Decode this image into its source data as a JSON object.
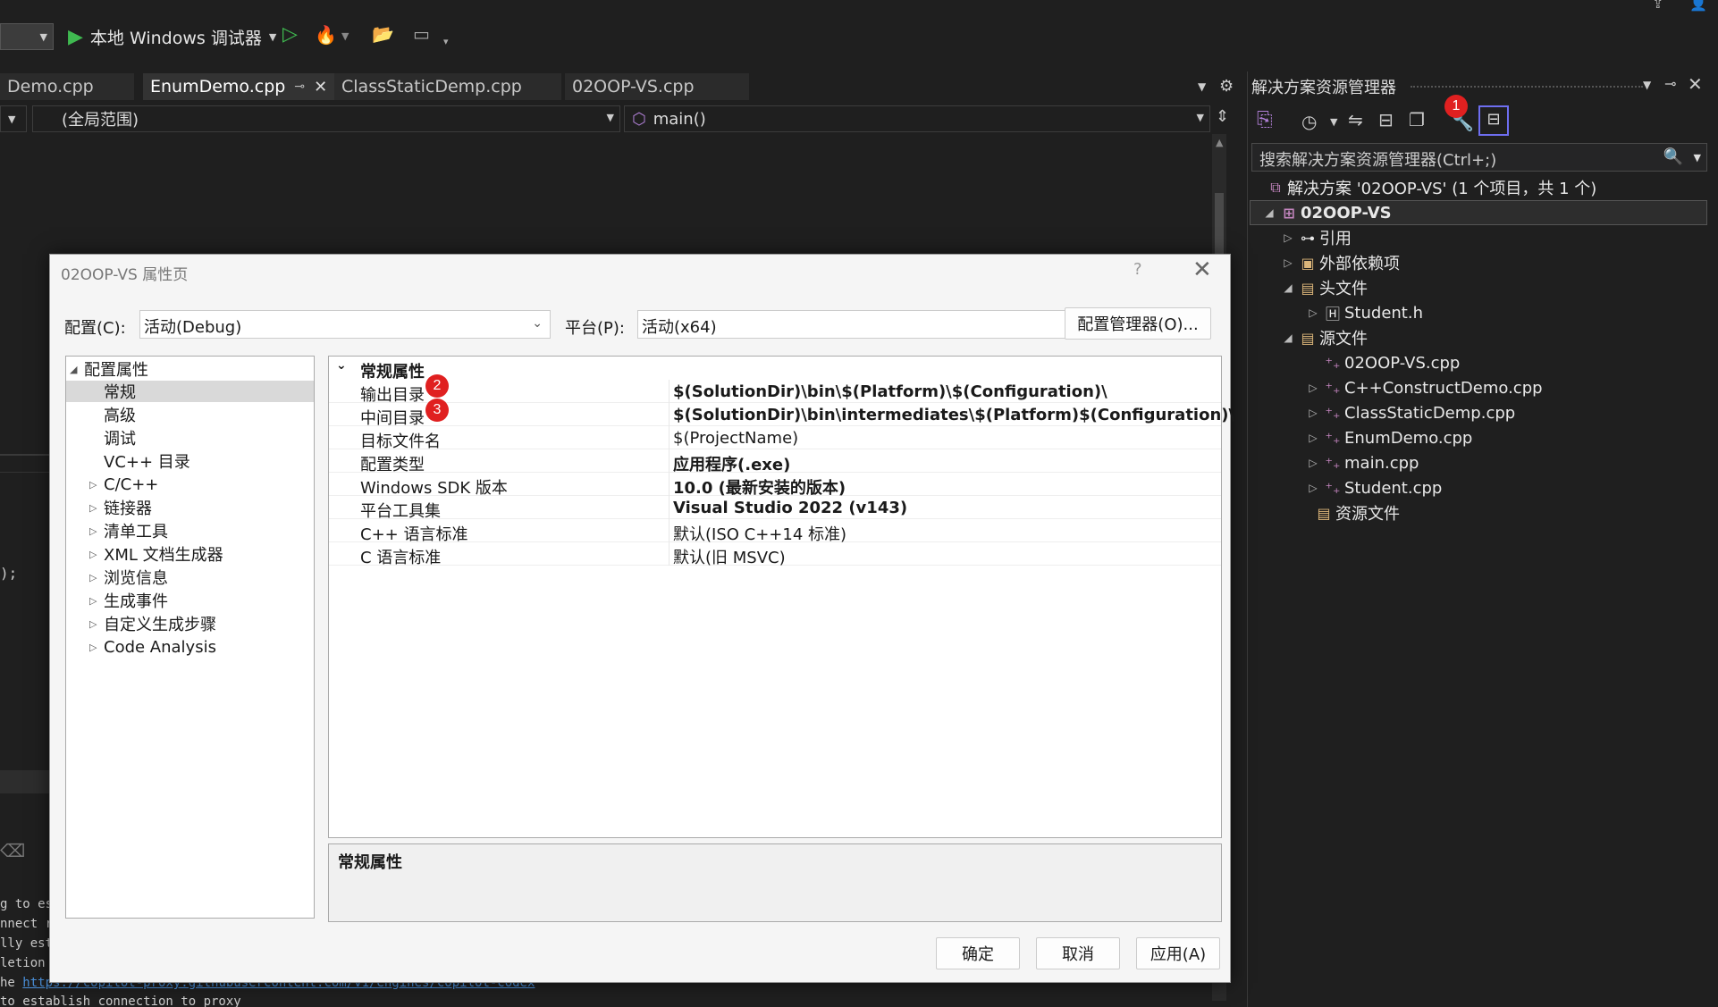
{
  "toolbar": {
    "debugger_label": "本地 Windows 调试器"
  },
  "editor": {
    "tabs": [
      {
        "label": "Demo.cpp"
      },
      {
        "label": "EnumDemo.cpp"
      },
      {
        "label": "ClassStaticDemp.cpp"
      },
      {
        "label": "02OOP-VS.cpp"
      }
    ],
    "scope": "(全局范围)",
    "member": "main()"
  },
  "output": {
    "lines": [
      "g to es",
      "nnect r",
      "lly est",
      "letion",
      "he ",
      "to establish connection to proxy"
    ],
    "link": "https://copilot-proxy.githubusercontent.com/v1/engines/copilot-codex",
    "code_fragment": ");"
  },
  "solution_explorer": {
    "title": "解决方案资源管理器",
    "search_placeholder": "搜索解决方案资源管理器(Ctrl+;)",
    "solution": "解决方案 '02OOP-VS' (1 个项目，共 1 个)",
    "project": "02OOP-VS",
    "items": [
      {
        "label": "引用"
      },
      {
        "label": "外部依赖项"
      },
      {
        "label": "头文件"
      },
      {
        "label": "Student.h"
      },
      {
        "label": "源文件"
      },
      {
        "label": "02OOP-VS.cpp"
      },
      {
        "label": "C++ConstructDemo.cpp"
      },
      {
        "label": "ClassStaticDemp.cpp"
      },
      {
        "label": "EnumDemo.cpp"
      },
      {
        "label": "main.cpp"
      },
      {
        "label": "Student.cpp"
      },
      {
        "label": "资源文件"
      }
    ]
  },
  "badges": [
    "1",
    "2",
    "3"
  ],
  "dialog": {
    "title": "02OOP-VS 属性页",
    "help": "?",
    "close": "✕",
    "config_label": "配置(C):",
    "config_value": "活动(Debug)",
    "platform_label": "平台(P):",
    "platform_value": "活动(x64)",
    "config_manager": "配置管理器(O)...",
    "left_tree": [
      {
        "label": "配置属性"
      },
      {
        "label": "常规"
      },
      {
        "label": "高级"
      },
      {
        "label": "调试"
      },
      {
        "label": "VC++ 目录"
      },
      {
        "label": "C/C++"
      },
      {
        "label": "链接器"
      },
      {
        "label": "清单工具"
      },
      {
        "label": "XML 文档生成器"
      },
      {
        "label": "浏览信息"
      },
      {
        "label": "生成事件"
      },
      {
        "label": "自定义生成步骤"
      },
      {
        "label": "Code Analysis"
      }
    ],
    "grid_header": "常规属性",
    "properties": [
      {
        "key": "输出目录",
        "value": "$(SolutionDir)\\bin\\$(Platform)\\$(Configuration)\\"
      },
      {
        "key": "中间目录",
        "value": "$(SolutionDir)\\bin\\intermediates\\$(Platform)$(Configuration)\\"
      },
      {
        "key": "目标文件名",
        "value": "$(ProjectName)"
      },
      {
        "key": "配置类型",
        "value": "应用程序(.exe)"
      },
      {
        "key": "Windows SDK 版本",
        "value": "10.0 (最新安装的版本)"
      },
      {
        "key": "平台工具集",
        "value": "Visual Studio 2022 (v143)"
      },
      {
        "key": "C++ 语言标准",
        "value": "默认(ISO C++14 标准)"
      },
      {
        "key": "C 语言标准",
        "value": "默认(旧 MSVC)"
      }
    ],
    "description_title": "常规属性",
    "ok": "确定",
    "cancel": "取消",
    "apply": "应用(A)"
  }
}
